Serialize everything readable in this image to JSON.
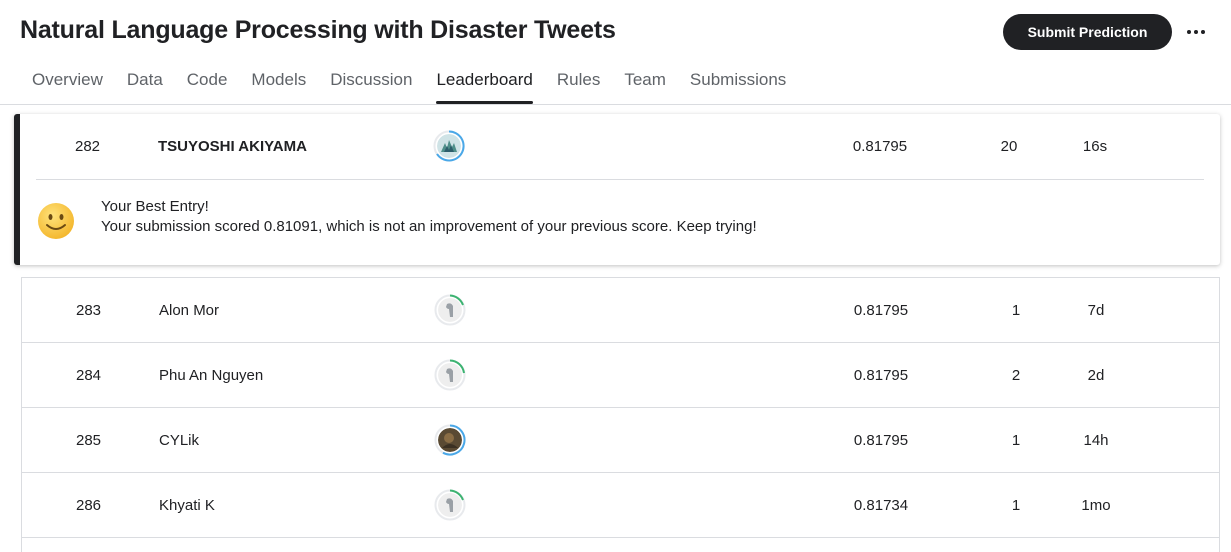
{
  "header": {
    "title": "Natural Language Processing with Disaster Tweets",
    "submit_label": "Submit Prediction",
    "more_icon": "more-horizontal-icon"
  },
  "tabs": [
    {
      "label": "Overview",
      "active": false
    },
    {
      "label": "Data",
      "active": false
    },
    {
      "label": "Code",
      "active": false
    },
    {
      "label": "Models",
      "active": false
    },
    {
      "label": "Discussion",
      "active": false
    },
    {
      "label": "Leaderboard",
      "active": true
    },
    {
      "label": "Rules",
      "active": false
    },
    {
      "label": "Team",
      "active": false
    },
    {
      "label": "Submissions",
      "active": false
    }
  ],
  "highlight": {
    "rank": "282",
    "name": "TSUYOSHI AKIYAMA",
    "score": "0.81795",
    "entries": "20",
    "last": "16s",
    "avatar_icon": "user-avatar-icon",
    "message_icon": "smiley-face-icon",
    "message_title": "Your Best Entry!",
    "message_body": "Your submission scored 0.81091, which is not an improvement of your previous score. Keep trying!"
  },
  "rows": [
    {
      "rank": "283",
      "name": "Alon Mor",
      "score": "0.81795",
      "entries": "1",
      "last": "7d"
    },
    {
      "rank": "284",
      "name": "Phu An Nguyen",
      "score": "0.81795",
      "entries": "2",
      "last": "2d"
    },
    {
      "rank": "285",
      "name": "CYLik",
      "score": "0.81795",
      "entries": "1",
      "last": "14h"
    },
    {
      "rank": "286",
      "name": "Khyati K",
      "score": "0.81734",
      "entries": "1",
      "last": "1mo"
    }
  ],
  "colors": {
    "text": "#202124",
    "muted": "#5f6368",
    "border": "#dadce0",
    "progress_blue": "#4aa8e8",
    "progress_green": "#3cb371"
  }
}
